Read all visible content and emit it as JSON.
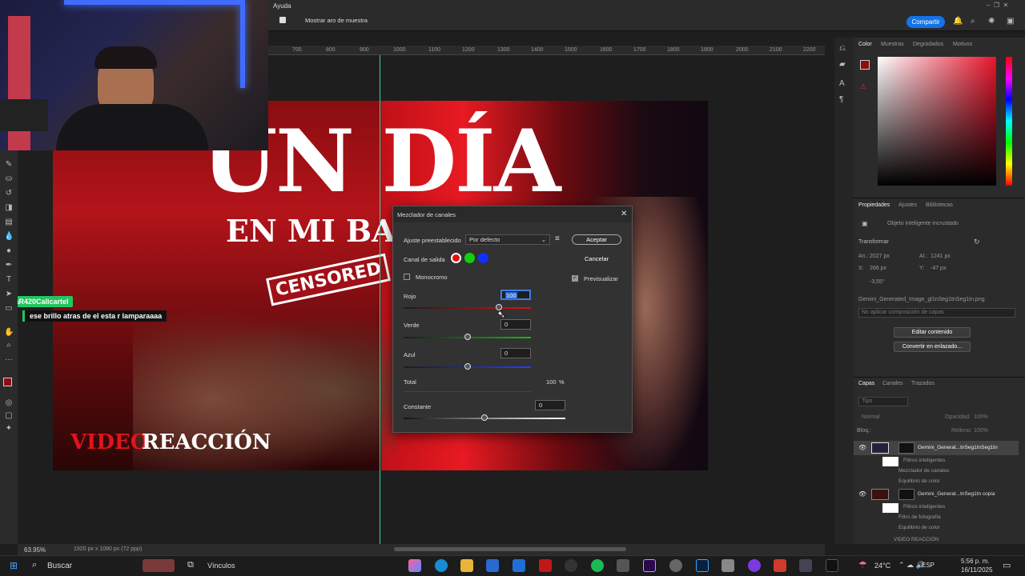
{
  "menu": {
    "help": "Ayuda"
  },
  "options": {
    "show_sample_ring": "Mostrar aro de muestra",
    "share": "Compartir"
  },
  "ruler_ticks": [
    "700",
    "800",
    "900",
    "1000",
    "1100",
    "1200",
    "1300",
    "1400",
    "1500",
    "1600",
    "1700",
    "1800",
    "1900",
    "2000",
    "2100",
    "2200"
  ],
  "chat": {
    "username": "LaR420Calicartel",
    "message": "ese brillo atras de el esta r lamparaaaa"
  },
  "artwork": {
    "title_line1": "UN DÍA",
    "title_line2": "EN MI BARR",
    "stamp": "CENSORED",
    "footer_red": "VIDEO",
    "footer_white": "REACCIÓN"
  },
  "dialog": {
    "title": "Mezclador de canales",
    "preset_label": "Ajuste preestablecido",
    "preset_value": "Por defecto",
    "accept": "Aceptar",
    "cancel": "Cancelar",
    "output_label": "Canal de salida",
    "monochrome": "Monocromo",
    "preview": "Previsualizar",
    "red_label": "Rojo",
    "red_value": "100",
    "green_label": "Verde",
    "green_value": "0",
    "blue_label": "Azul",
    "blue_value": "0",
    "total_label": "Total",
    "total_value": "100",
    "total_unit": "%",
    "constant_label": "Constante",
    "constant_value": "0",
    "colors": {
      "red": "#e01010",
      "green": "#10d010",
      "blue": "#1030ff"
    },
    "slider_levels": {
      "red": 100,
      "green": 0,
      "blue": 0,
      "constant": 0
    }
  },
  "color_panel": {
    "tabs": [
      "Color",
      "Muestras",
      "Degradados",
      "Motivos"
    ]
  },
  "props_panel": {
    "tabs": [
      "Propiedades",
      "Ajustes",
      "Bibliotecas"
    ],
    "object_type": "Objeto inteligente incrustado",
    "transform": "Transformar",
    "w_label": "An.:",
    "w_value": "2027 px",
    "h_label": "Al.:",
    "h_value": "1241 px",
    "x_label": "X:",
    "x_value": "266 px",
    "y_label": "Y:",
    "y_value": "-47 px",
    "angle": "-3,55°",
    "filename": "Gemini_Generated_Image_gl1nSeg1tnSeg1tn.png",
    "comp": "No aplicar composición de capas",
    "edit_contents": "Editar contenido",
    "convert_linked": "Convertir en enlazado..."
  },
  "layers_panel": {
    "tabs": [
      "Capas",
      "Canales",
      "Trazados"
    ],
    "search": "Tipo",
    "blend": "Normal",
    "opacity_label": "Opacidad:",
    "opacity_value": "100%",
    "lock_label": "Bloq.:",
    "fill_label": "Relleno:",
    "fill_value": "100%",
    "layers": [
      {
        "name": "Gemini_Generat...tnSeg1tnSeg1tn"
      },
      {
        "name": "Filtros inteligentes"
      },
      {
        "name": "Mezclador de canales"
      },
      {
        "name": "Equilibrio de color"
      },
      {
        "name": "Gemini_Generat...tnSeg1tn copia"
      },
      {
        "name": "Filtros inteligentes"
      },
      {
        "name": "Filtro de fotografía"
      },
      {
        "name": "Equilibrio de color"
      },
      {
        "name": "VIDEO REACCIÓN"
      }
    ]
  },
  "status": {
    "zoom": "63.95%",
    "doc_info": "1920 px x 1080 px (72 ppp)"
  },
  "taskbar": {
    "search": "Buscar",
    "links": "Vínculos",
    "temp": "24°C",
    "lang": "ESP",
    "time": "5:56 p. m.",
    "date": "16/11/2025"
  }
}
